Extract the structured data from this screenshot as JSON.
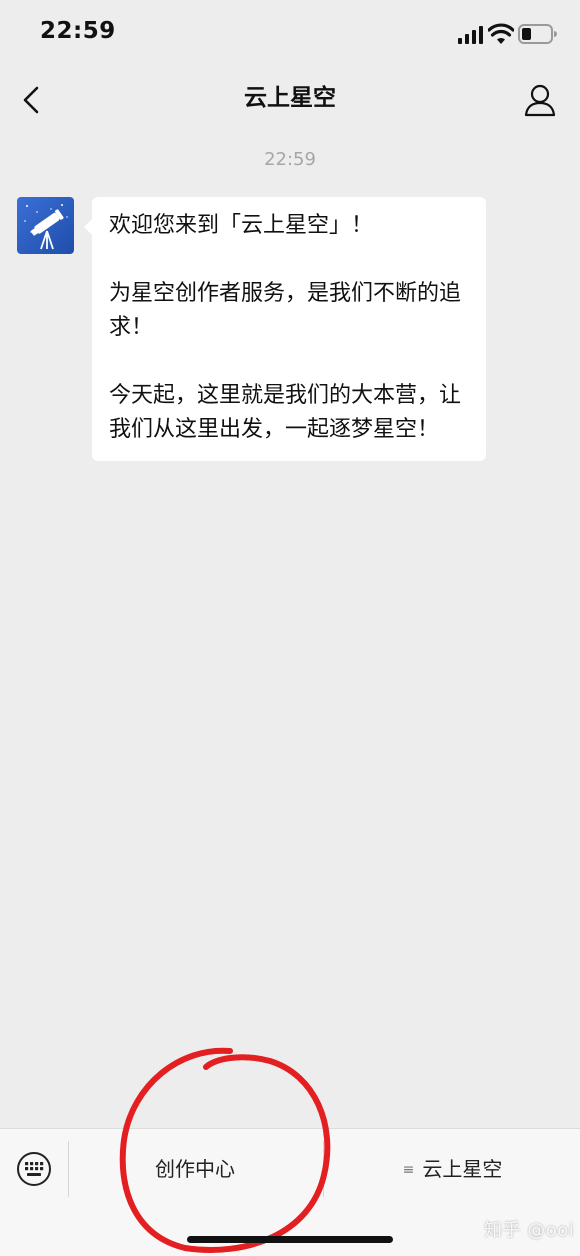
{
  "status_bar": {
    "time": "22:59"
  },
  "nav": {
    "title": "云上星空"
  },
  "chat": {
    "timestamp": "22:59",
    "message_paragraphs": [
      "欢迎您来到「云上星空」！",
      "为星空创作者服务，是我们不断的追求！",
      "今天起，这里就是我们的大本营，让我们从这里出发，一起逐梦星空！"
    ]
  },
  "bottom_menu": {
    "item1": "创作中心",
    "item2": "云上星空",
    "item2_glyph": "≡"
  },
  "watermark": "知乎 @ooi",
  "colors": {
    "background": "#ededed",
    "bubble": "#ffffff",
    "avatar": "#2d5fc4",
    "annotation": "#e41f22"
  }
}
